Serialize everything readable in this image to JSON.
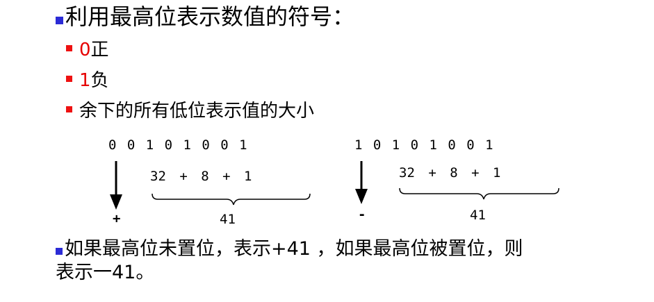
{
  "heading": "利用最高位表示数值的符号：",
  "bullets": [
    {
      "digit": "0",
      "text": "正"
    },
    {
      "digit": "1",
      "text": "负"
    },
    {
      "digit": "",
      "text": "余下的所有低位表示值的大小"
    }
  ],
  "left_example": {
    "bits": "0 0 1 0  1 0 0 1",
    "sum": "32  + 8 +   1",
    "total": "41",
    "sign": "+"
  },
  "right_example": {
    "bits": "1 0 1 0  1 0 0 1",
    "sum": "32  + 8 +   1",
    "total": "41",
    "sign": "-"
  },
  "footer": {
    "line1": "如果最高位未置位，表示+41 ，如果最高位被置位，则",
    "line2": "表示一41。"
  }
}
